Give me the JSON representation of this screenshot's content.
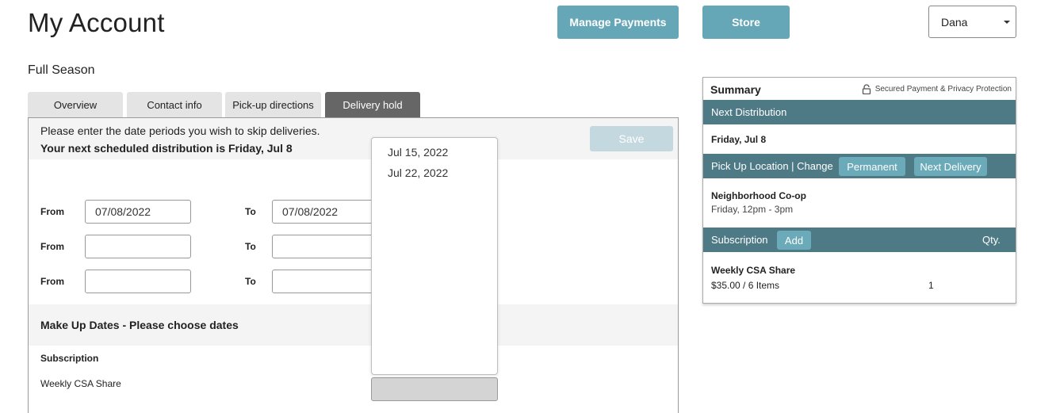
{
  "header": {
    "title": "My Account",
    "manage_payments_label": "Manage Payments",
    "store_label": "Store",
    "user_select_value": "Dana"
  },
  "season": "Full Season",
  "tabs": [
    {
      "label": "Overview",
      "active": false
    },
    {
      "label": "Contact info",
      "active": false
    },
    {
      "label": "Pick-up directions",
      "active": false
    },
    {
      "label": "Delivery hold",
      "active": true
    }
  ],
  "delivery_hold": {
    "instruction": "Please enter the date periods you wish to skip deliveries.",
    "next_distribution_note": "Your next scheduled distribution is Friday, Jul 8",
    "save_label": "Save",
    "from_label": "From",
    "to_label": "To",
    "periods": [
      {
        "from": "07/08/2022",
        "to": "07/08/2022"
      },
      {
        "from": "",
        "to": ""
      },
      {
        "from": "",
        "to": ""
      }
    ],
    "makeup_title": "Make Up Dates - Please choose dates",
    "subscription_heading": "Subscription",
    "subscription_item": "Weekly CSA Share",
    "makeup_dropdown_options": [
      "Jul 15, 2022",
      "Jul 22, 2022"
    ]
  },
  "summary": {
    "title": "Summary",
    "secure_text": "Secured Payment & Privacy Protection",
    "next_distribution_label": "Next Distribution",
    "next_distribution_value": "Friday, Jul 8",
    "pickup_label": "Pick Up Location | Change",
    "permanent_label": "Permanent",
    "next_delivery_label": "Next Delivery",
    "location_name": "Neighborhood Co-op",
    "location_hours": "Friday, 12pm - 3pm",
    "subscription_label": "Subscription",
    "add_label": "Add",
    "qty_label": "Qty.",
    "item_name": "Weekly CSA Share",
    "item_price": "$35.00 / 6 Items",
    "item_qty": "1"
  },
  "colors": {
    "accent_button": "#65a7b6",
    "summary_bar": "#4e7a85",
    "active_tab": "#666666",
    "save_disabled": "#c4d8df"
  }
}
